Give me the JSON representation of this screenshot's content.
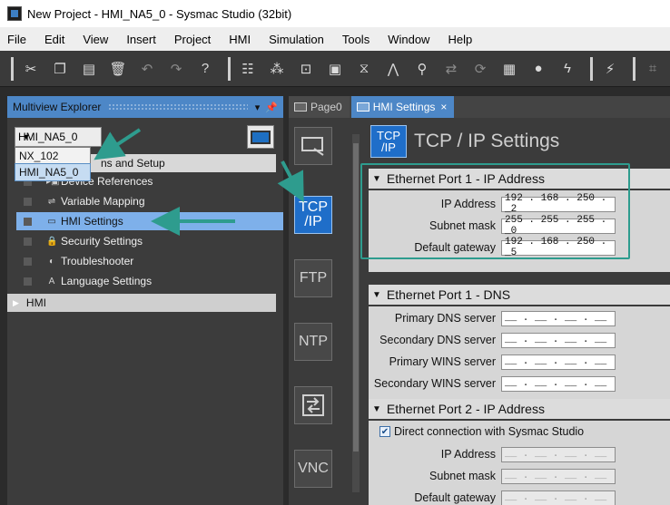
{
  "window": {
    "title": "New Project - HMI_NA5_0 - Sysmac Studio (32bit)"
  },
  "menu": [
    "File",
    "Edit",
    "View",
    "Insert",
    "Project",
    "HMI",
    "Simulation",
    "Tools",
    "Window",
    "Help"
  ],
  "explorer": {
    "header": "Multiview Explorer",
    "pin_icon": "pin-icon",
    "device_select": {
      "value": "HMI_NA5_0",
      "options": [
        "NX_102",
        "HMI_NA5_0"
      ],
      "selected_index": 1
    },
    "config_label": "ns and Setup",
    "items": [
      {
        "label": "Device References",
        "icon": "device-icon"
      },
      {
        "label": "Variable Mapping",
        "icon": "mapping-icon"
      },
      {
        "label": "HMI Settings",
        "icon": "hmi-icon",
        "selected": true
      },
      {
        "label": "Security Settings",
        "icon": "security-icon"
      },
      {
        "label": "Troubleshooter",
        "icon": "troubleshooter-icon"
      },
      {
        "label": "Language Settings",
        "icon": "language-icon"
      }
    ],
    "hmi_section": "HMI"
  },
  "tabs": [
    {
      "label": "Page0",
      "active": false
    },
    {
      "label": "HMI Settings",
      "active": true,
      "close": "×"
    }
  ],
  "side_nav": [
    {
      "label": "",
      "icon": "display-icon"
    },
    {
      "label": "TCP\n/IP",
      "active": true
    },
    {
      "label": "FTP"
    },
    {
      "label": "NTP"
    },
    {
      "label": "",
      "icon": "transfer-icon"
    },
    {
      "label": "VNC"
    }
  ],
  "content": {
    "title": "TCP / IP Settings",
    "title_icon": "TCP\n/IP",
    "sections": [
      {
        "title": "Ethernet Port 1 - IP Address",
        "fields": [
          {
            "label": "IP Address",
            "value": "192 . 168 . 250 . _2"
          },
          {
            "label": "Subnet mask",
            "value": "255 . 255 . 255 . _0"
          },
          {
            "label": "Default gateway",
            "value": "192 . 168 . 250 . _5"
          }
        ]
      },
      {
        "title": "Ethernet Port 1 - DNS",
        "fields": [
          {
            "label": "Primary DNS server",
            "value": "__ . __ . __ . __"
          },
          {
            "label": "Secondary DNS server",
            "value": "__ . __ . __ . __"
          },
          {
            "label": "Primary WINS server",
            "value": "__ . __ . __ . __"
          },
          {
            "label": "Secondary WINS server",
            "value": "__ . __ . __ . __"
          }
        ]
      },
      {
        "title": "Ethernet Port 2 - IP Address",
        "checkbox": {
          "label": "Direct connection with Sysmac Studio",
          "checked": true
        },
        "fields": [
          {
            "label": "IP Address",
            "value": "__ . __ . __ . __",
            "disabled": true
          },
          {
            "label": "Subnet mask",
            "value": "__ . __ . __ . __",
            "disabled": true
          },
          {
            "label": "Default gateway",
            "value": "__ . __ . __ . __",
            "disabled": true
          }
        ]
      }
    ]
  },
  "colors": {
    "accent": "#4d87c7",
    "highlight": "#2e9c8e",
    "selected": "#7eb0ea"
  }
}
